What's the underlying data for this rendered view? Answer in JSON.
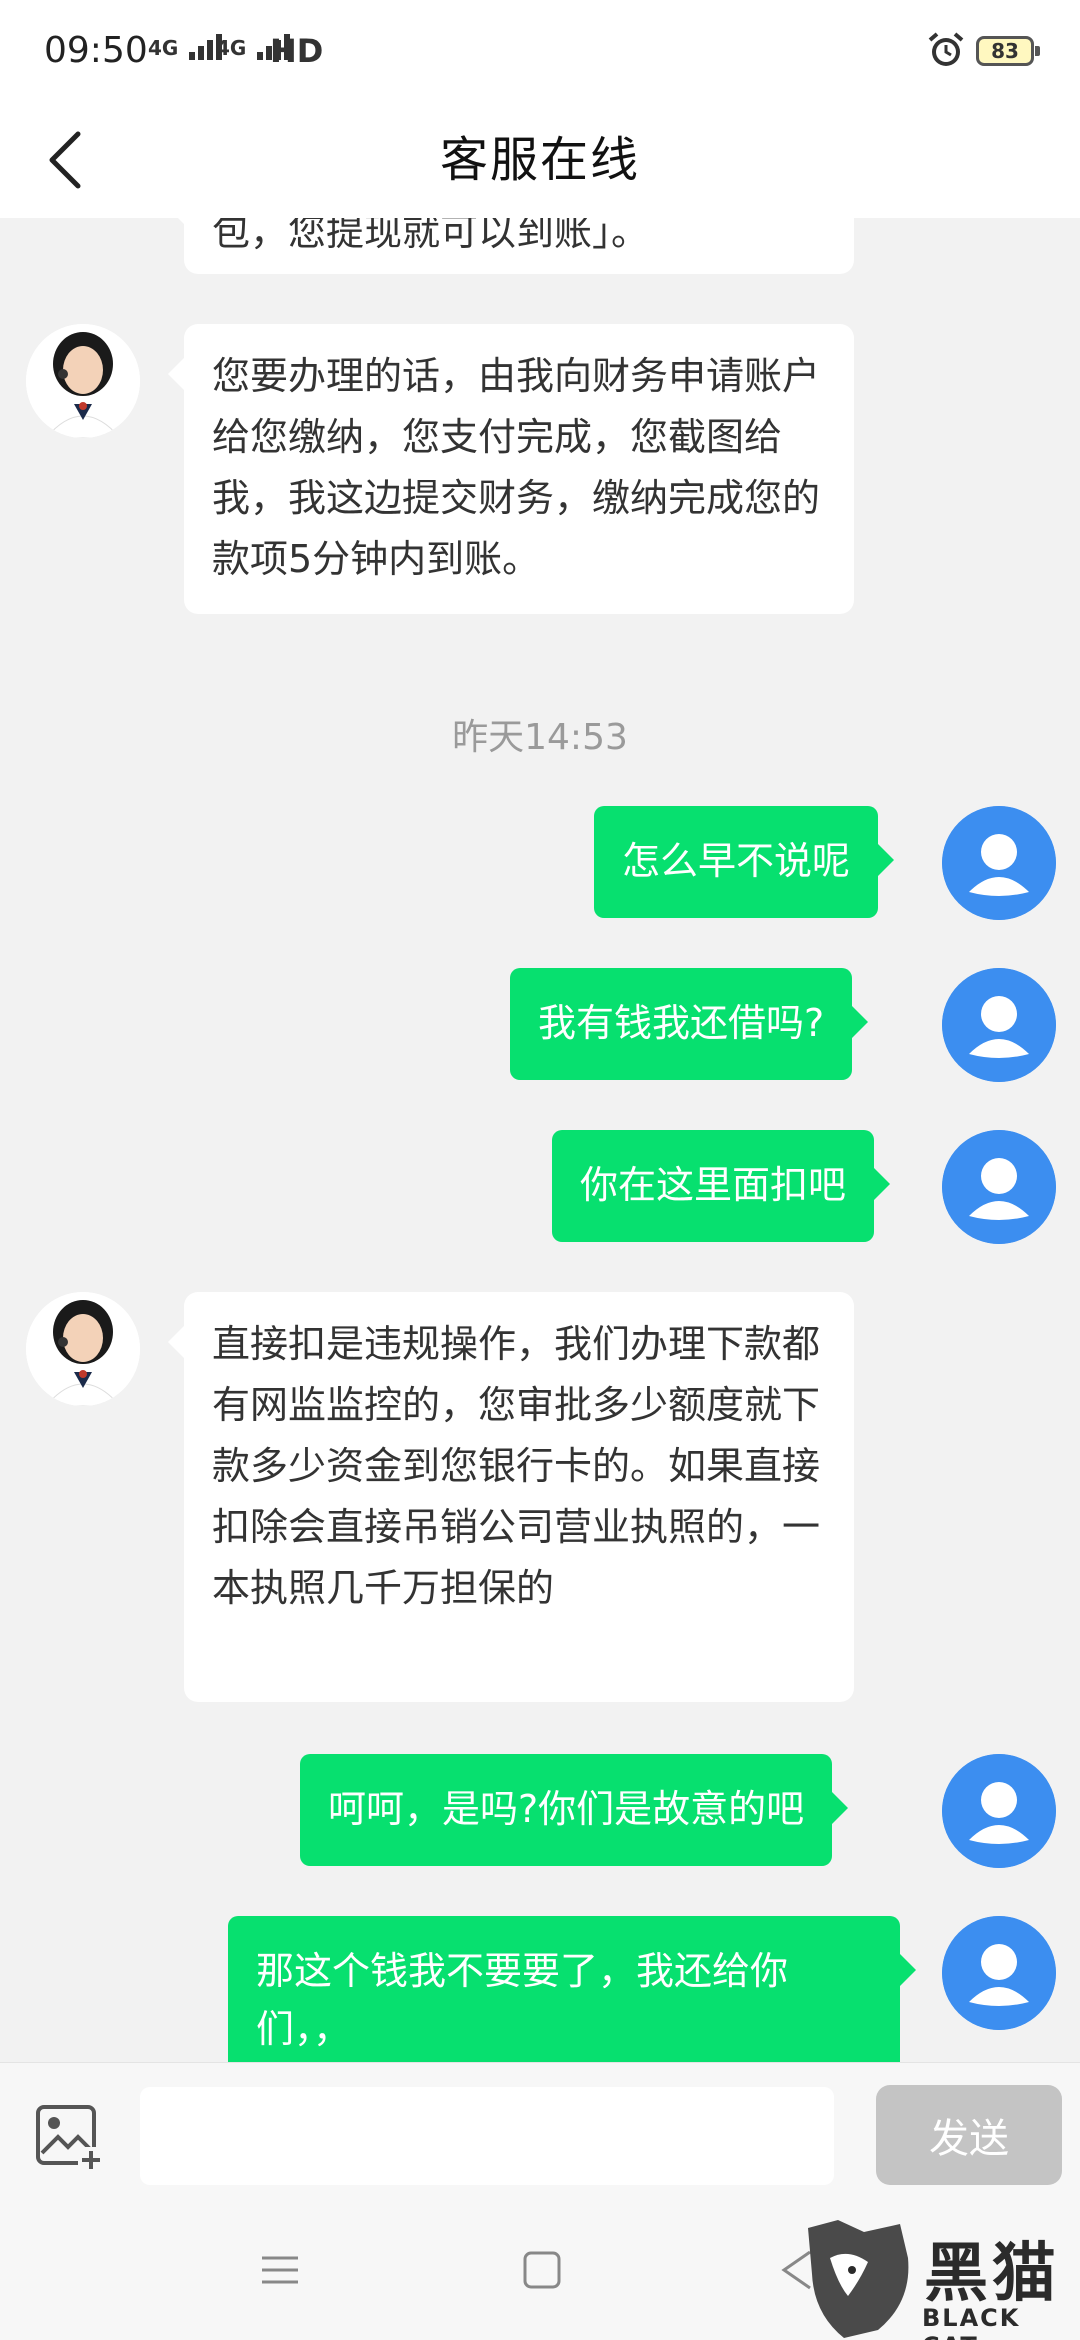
{
  "status_bar": {
    "time": "09:50",
    "network1": "4G",
    "network2": "4G",
    "hd": "HD",
    "battery": "83"
  },
  "header": {
    "title": "客服在线"
  },
  "messages": [
    {
      "side": "agent",
      "text": "包，您提现就可以到账」。"
    },
    {
      "side": "agent",
      "text": "您要办理的话，由我向财务申请账户给您缴纳，您支付完成，您截图给我，我这边提交财务，缴纳完成您的款项5分钟内到账。"
    },
    {
      "side": "time",
      "text": "昨天14:53"
    },
    {
      "side": "user",
      "text": "怎么早不说呢"
    },
    {
      "side": "user",
      "text": "我有钱我还借吗?"
    },
    {
      "side": "user",
      "text": "你在这里面扣吧"
    },
    {
      "side": "agent",
      "text": "直接扣是违规操作，我们办理下款都有网监监控的，您审批多少额度就下款多少资金到您银行卡的。如果直接扣除会直接吊销公司营业执照的，一本执照几千万担保的"
    },
    {
      "side": "user",
      "text": "呵呵，是吗?你们是故意的吧"
    },
    {
      "side": "user",
      "text": "那这个钱我不要要了，我还给你们，，"
    }
  ],
  "input": {
    "placeholder": "",
    "send_label": "发送"
  },
  "watermark": {
    "cn": "黑猫",
    "en": "BLACK CAT"
  },
  "colors": {
    "user_bubble": "#07e06f",
    "agent_bubble": "#ffffff",
    "user_avatar": "#3c8ef0",
    "send_disabled": "#c4c4c4"
  }
}
